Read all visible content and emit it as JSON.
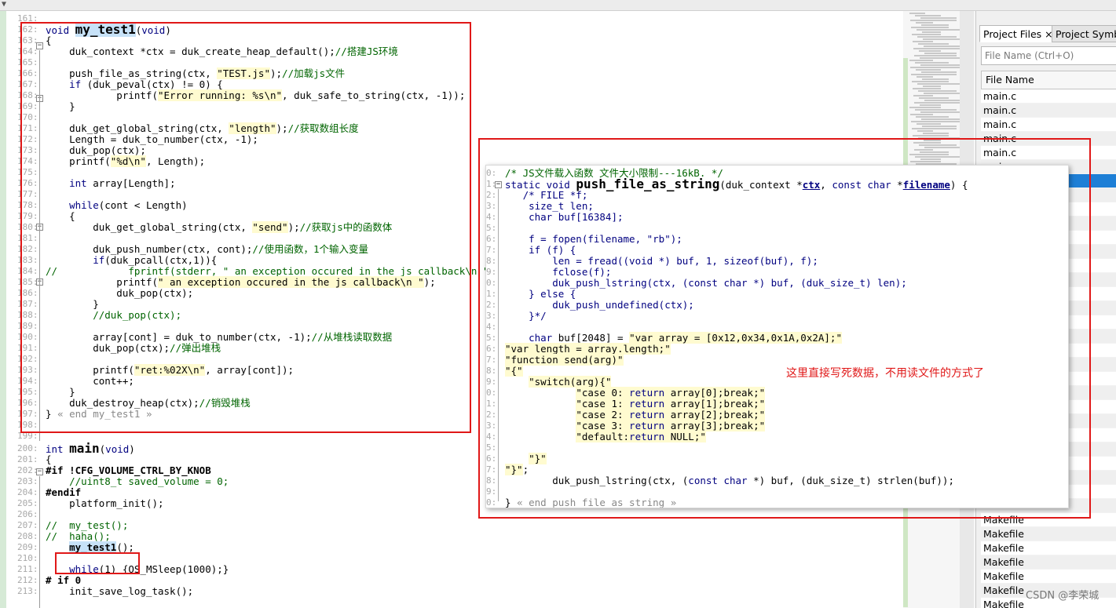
{
  "window": {
    "top_arrow": "▼"
  },
  "editor": {
    "lines": [
      {
        "n": "161:",
        "t": ""
      },
      {
        "n": "162:",
        "t": "void my_test1(void)"
      },
      {
        "n": "163:",
        "t": "{"
      },
      {
        "n": "164:",
        "t": "    duk_context *ctx = duk_create_heap_default();//搭建JS环境"
      },
      {
        "n": "165:",
        "t": ""
      },
      {
        "n": "166:",
        "t": "    push_file_as_string(ctx, \"TEST.js\");//加载js文件"
      },
      {
        "n": "167:",
        "t": "    if (duk_peval(ctx) != 0) {"
      },
      {
        "n": "168:",
        "t": "            printf(\"Error running: %s\\n\", duk_safe_to_string(ctx, -1));"
      },
      {
        "n": "169:",
        "t": "    }"
      },
      {
        "n": "170:",
        "t": ""
      },
      {
        "n": "171:",
        "t": "    duk_get_global_string(ctx, \"length\");//获取数组长度"
      },
      {
        "n": "172:",
        "t": "    Length = duk_to_number(ctx, -1);"
      },
      {
        "n": "173:",
        "t": "    duk_pop(ctx);"
      },
      {
        "n": "174:",
        "t": "    printf(\"%d\\n\", Length);"
      },
      {
        "n": "175:",
        "t": ""
      },
      {
        "n": "176:",
        "t": "    int array[Length];"
      },
      {
        "n": "177:",
        "t": ""
      },
      {
        "n": "178:",
        "t": "    while(cont < Length)"
      },
      {
        "n": "179:",
        "t": "    {"
      },
      {
        "n": "180:",
        "t": "        duk_get_global_string(ctx, \"send\");//获取js中的函数体"
      },
      {
        "n": "181:",
        "t": ""
      },
      {
        "n": "182:",
        "t": "        duk_push_number(ctx, cont);//使用函数，1个输入变量"
      },
      {
        "n": "183:",
        "t": "        if(duk_pcall(ctx,1)){"
      },
      {
        "n": "184:",
        "t": "//            fprintf(stderr, \" an exception occured in the js callback\\n \");"
      },
      {
        "n": "185:",
        "t": "            printf(\" an exception occured in the js callback\\n \");"
      },
      {
        "n": "186:",
        "t": "            duk_pop(ctx);"
      },
      {
        "n": "187:",
        "t": "        }"
      },
      {
        "n": "188:",
        "t": "        //duk_pop(ctx);"
      },
      {
        "n": "189:",
        "t": ""
      },
      {
        "n": "190:",
        "t": "        array[cont] = duk_to_number(ctx, -1);//从堆栈读取数据"
      },
      {
        "n": "191:",
        "t": "        duk_pop(ctx);//弹出堆栈"
      },
      {
        "n": "192:",
        "t": ""
      },
      {
        "n": "193:",
        "t": "        printf(\"ret:%02X\\n\", array[cont]);"
      },
      {
        "n": "194:",
        "t": "        cont++;"
      },
      {
        "n": "195:",
        "t": "    }"
      },
      {
        "n": "196:",
        "t": "    duk_destroy_heap(ctx);//销毁堆栈"
      },
      {
        "n": "197:",
        "t": "} « end my_test1 »"
      },
      {
        "n": "198:",
        "t": ""
      },
      {
        "n": "199:",
        "t": ""
      },
      {
        "n": "200:",
        "t": "int main(void)"
      },
      {
        "n": "201:",
        "t": "{"
      },
      {
        "n": "202:",
        "t": "#if !CFG_VOLUME_CTRL_BY_KNOB"
      },
      {
        "n": "203:",
        "t": "    //uint8_t saved_volume = 0;"
      },
      {
        "n": "204:",
        "t": "#endif"
      },
      {
        "n": "205:",
        "t": "    platform_init();"
      },
      {
        "n": "206:",
        "t": ""
      },
      {
        "n": "207:",
        "t": "//  my_test();"
      },
      {
        "n": "208:",
        "t": "//  haha();"
      },
      {
        "n": "209:",
        "t": "    my_test1();"
      },
      {
        "n": "210:",
        "t": ""
      },
      {
        "n": "211:",
        "t": "    while(1) {OS_MSleep(1000);}"
      },
      {
        "n": "212:",
        "t": "# if 0"
      },
      {
        "n": "213:",
        "t": "    init_save_log_task();"
      }
    ]
  },
  "popup": {
    "lines": [
      {
        "n": "0:",
        "t": "/* JS文件载入函数 文件大小限制---16kB. */"
      },
      {
        "n": "1:",
        "t": "static void push_file_as_string(duk_context *ctx, const char *filename) {"
      },
      {
        "n": "2:",
        "t": "   /* FILE *f;"
      },
      {
        "n": "3:",
        "t": "    size_t len;"
      },
      {
        "n": "4:",
        "t": "    char buf[16384];"
      },
      {
        "n": "5:",
        "t": ""
      },
      {
        "n": "6:",
        "t": "    f = fopen(filename, \"rb\");"
      },
      {
        "n": "7:",
        "t": "    if (f) {"
      },
      {
        "n": "8:",
        "t": "        len = fread((void *) buf, 1, sizeof(buf), f);"
      },
      {
        "n": "9:",
        "t": "        fclose(f);"
      },
      {
        "n": "0:",
        "t": "        duk_push_lstring(ctx, (const char *) buf, (duk_size_t) len);"
      },
      {
        "n": "1:",
        "t": "    } else {"
      },
      {
        "n": "2:",
        "t": "        duk_push_undefined(ctx);"
      },
      {
        "n": "3:",
        "t": "    }*/"
      },
      {
        "n": "4:",
        "t": ""
      },
      {
        "n": "5:",
        "t": "    char buf[2048] = \"var array = [0x12,0x34,0x1A,0x2A];\""
      },
      {
        "n": "6:",
        "t": "\"var length = array.length;\""
      },
      {
        "n": "7:",
        "t": "\"function send(arg)\""
      },
      {
        "n": "8:",
        "t": "\"{\""
      },
      {
        "n": "9:",
        "t": "    \"switch(arg){\""
      },
      {
        "n": "0:",
        "t": "            \"case 0: return array[0];break;\""
      },
      {
        "n": "1:",
        "t": "            \"case 1: return array[1];break;\""
      },
      {
        "n": "2:",
        "t": "            \"case 2: return array[2];break;\""
      },
      {
        "n": "3:",
        "t": "            \"case 3: return array[3];break;\""
      },
      {
        "n": "4:",
        "t": "            \"default:return NULL;\""
      },
      {
        "n": "5:",
        "t": ""
      },
      {
        "n": "6:",
        "t": "    \"}\""
      },
      {
        "n": "7:",
        "t": "\"}\";"
      },
      {
        "n": "8:",
        "t": "        duk_push_lstring(ctx, (const char *) buf, (duk_size_t) strlen(buf));"
      },
      {
        "n": "9:",
        "t": ""
      },
      {
        "n": "0:",
        "t": "} « end push_file_as_string »"
      },
      {
        "n": "1:",
        "t": ""
      }
    ]
  },
  "annotation": "这里直接写死数据，不用读文件的方式了",
  "panel": {
    "tabs": [
      "Project Files",
      "Project Symbo"
    ],
    "tab_close": "×",
    "search_placeholder": "File Name (Ctrl+O)",
    "column_header": "File Name",
    "files": [
      "main.c",
      "main.c",
      "main.c",
      "main.c",
      "main.c",
      "main.c",
      "main.c",
      "",
      "",
      "",
      "",
      "",
      "",
      "",
      "",
      "",
      "",
      "",
      "",
      "",
      "",
      "",
      "",
      "",
      "",
      "",
      "",
      "",
      "",
      "",
      "Makefile",
      "Makefile",
      "Makefile",
      "Makefile",
      "Makefile",
      "Makefile",
      "Makefile",
      "Makefile"
    ],
    "selected_index": 6
  },
  "watermark": "CSDN @李荣城",
  "colors": {
    "red_box": "#e01818",
    "selection": "#1e7fd6",
    "highlight": "#c7e2f8"
  }
}
